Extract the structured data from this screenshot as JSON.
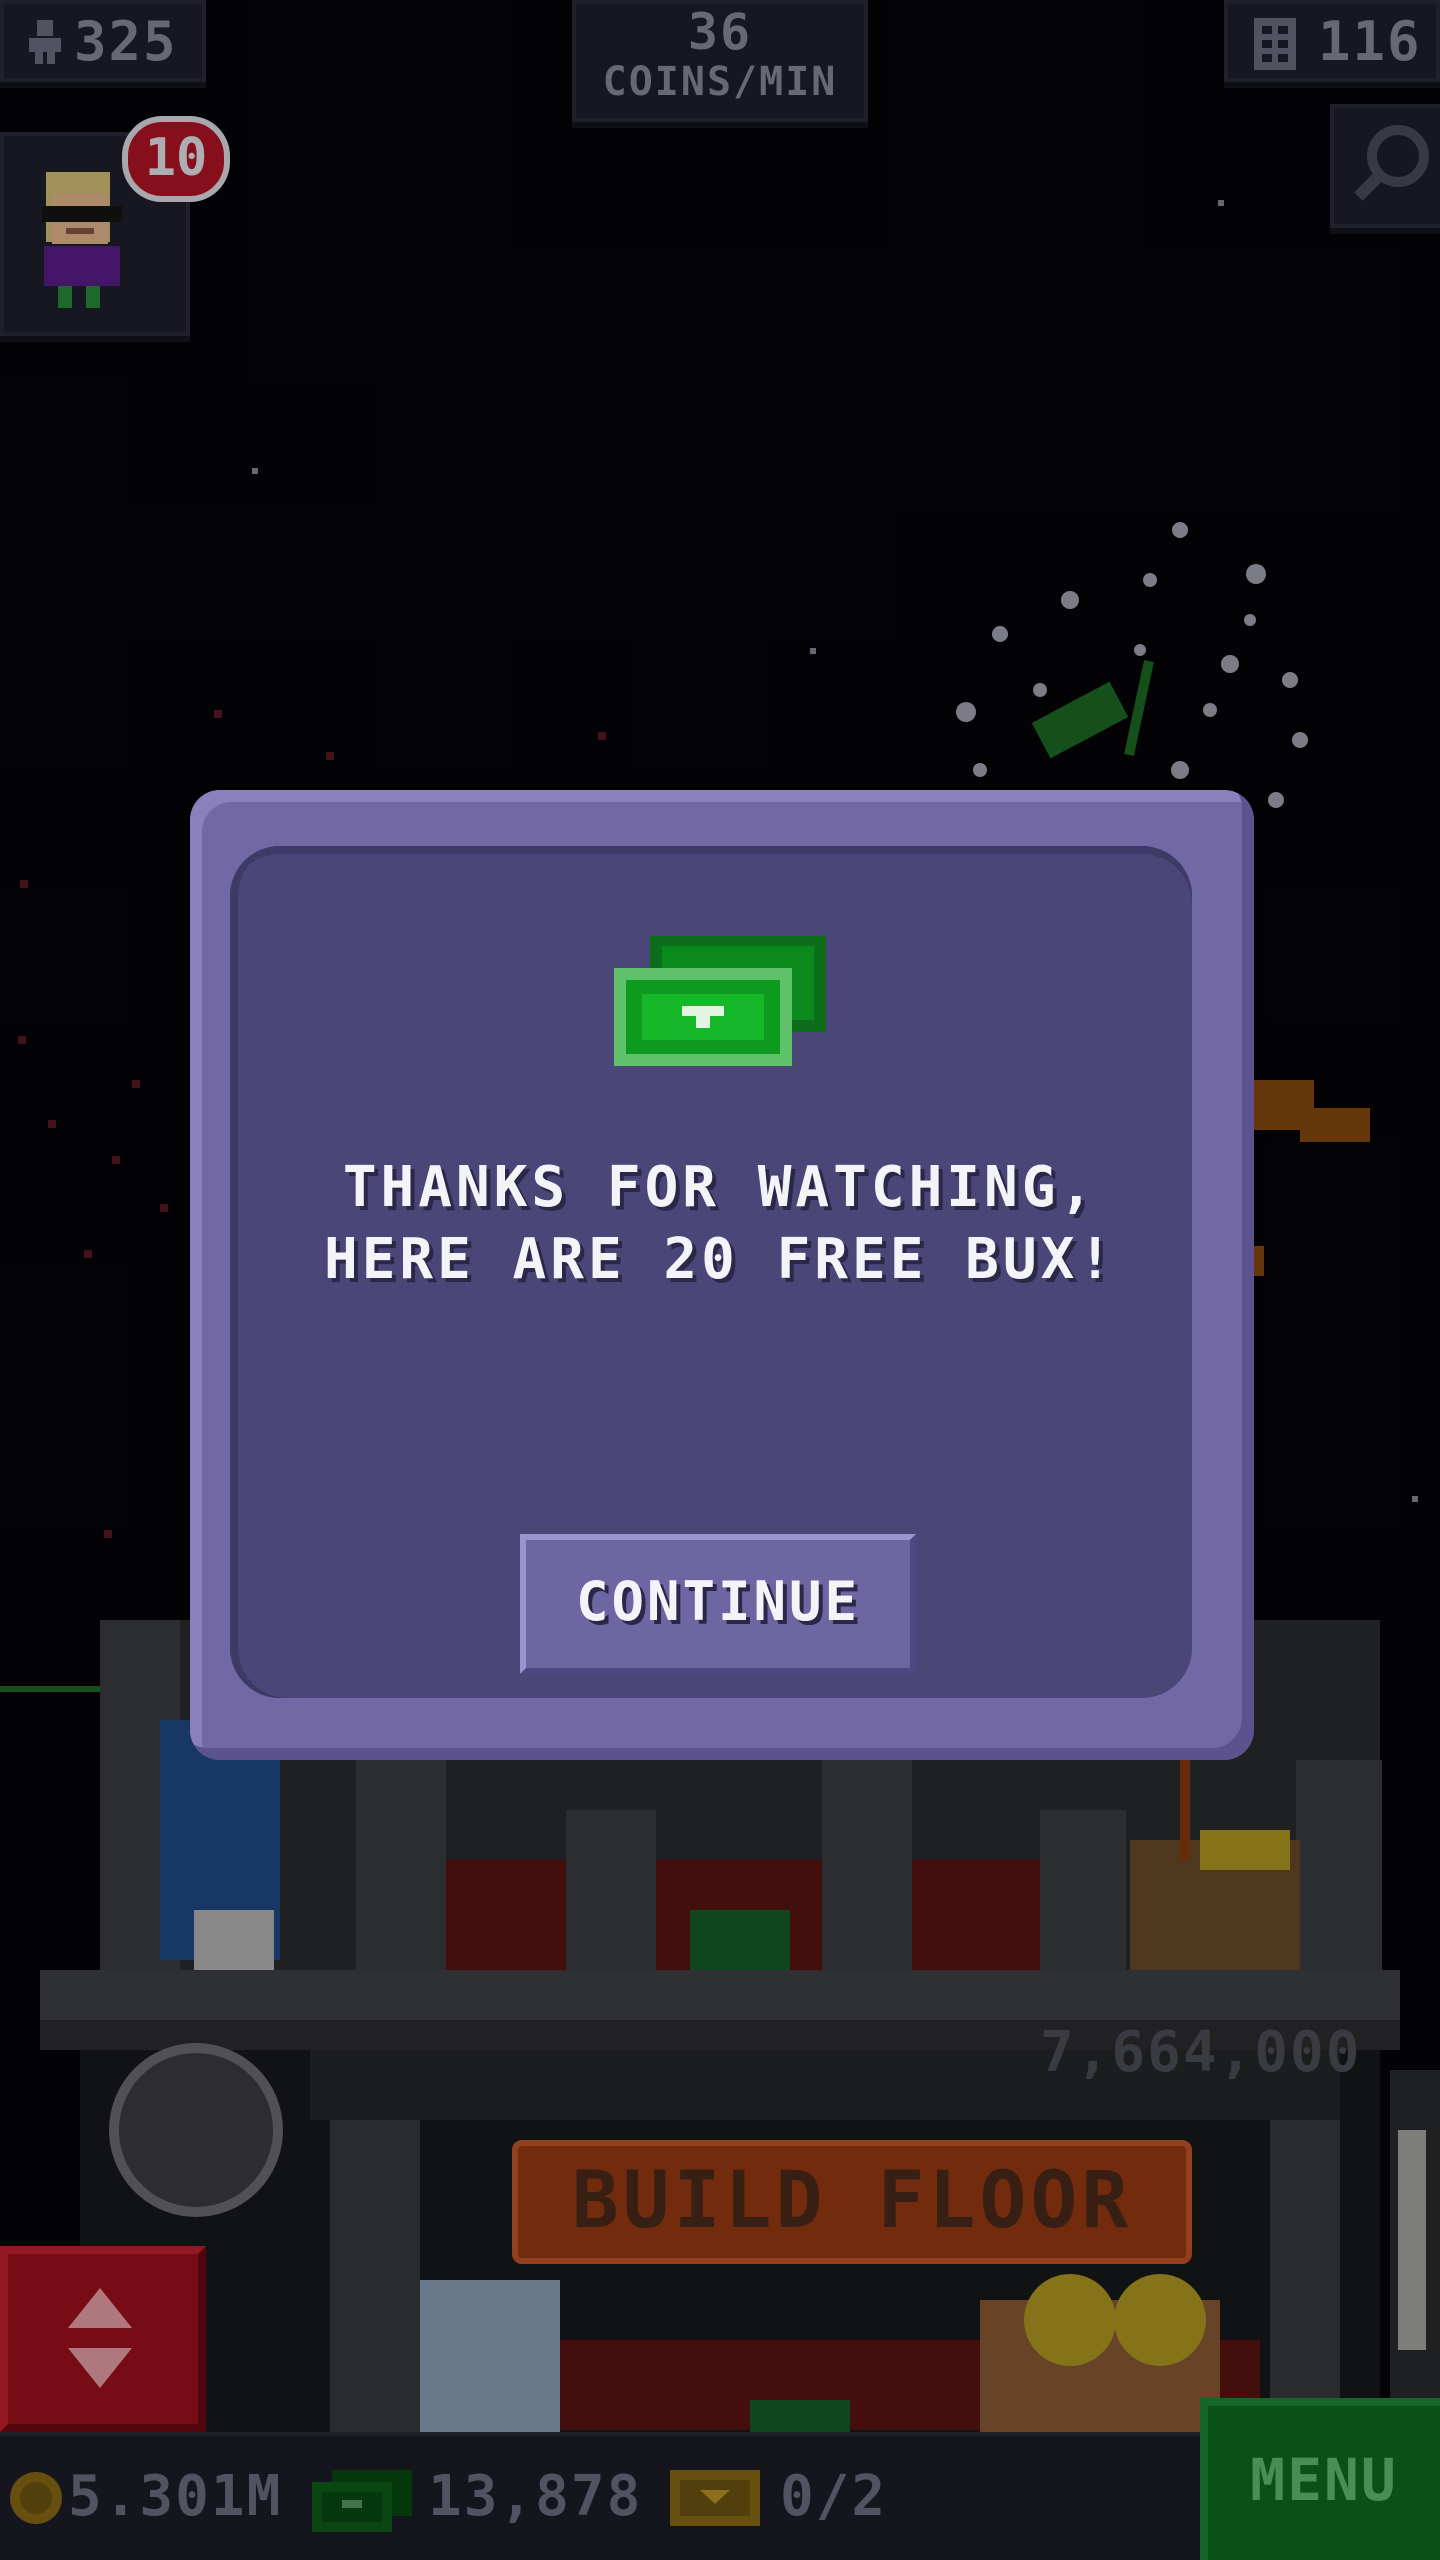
{
  "hud": {
    "population": "325",
    "coin_rate_value": "36",
    "coin_rate_unit": "COINS/MIN",
    "floors": "116",
    "visitor_badge_count": "10"
  },
  "dialog": {
    "message_line1": "THANKS FOR WATCHING,",
    "message_line2": "HERE ARE 20 FREE BUX!",
    "continue_label": "CONTINUE",
    "icon": "bux-bill-icon"
  },
  "tower": {
    "build_floor_label": "BUILD FLOOR",
    "build_floor_cost": "7,664,000"
  },
  "bottom_bar": {
    "coins": "5.301M",
    "bux": "13,878",
    "tickets": "0/2",
    "menu_label": "MENU"
  },
  "colors": {
    "dialog_outer": "#7268a6",
    "dialog_inner": "#4a4678",
    "bux_green": "#12a81e",
    "menu_green": "#0f6a22",
    "build_orange": "#9a3a12",
    "elevator_red": "#a0101c"
  }
}
